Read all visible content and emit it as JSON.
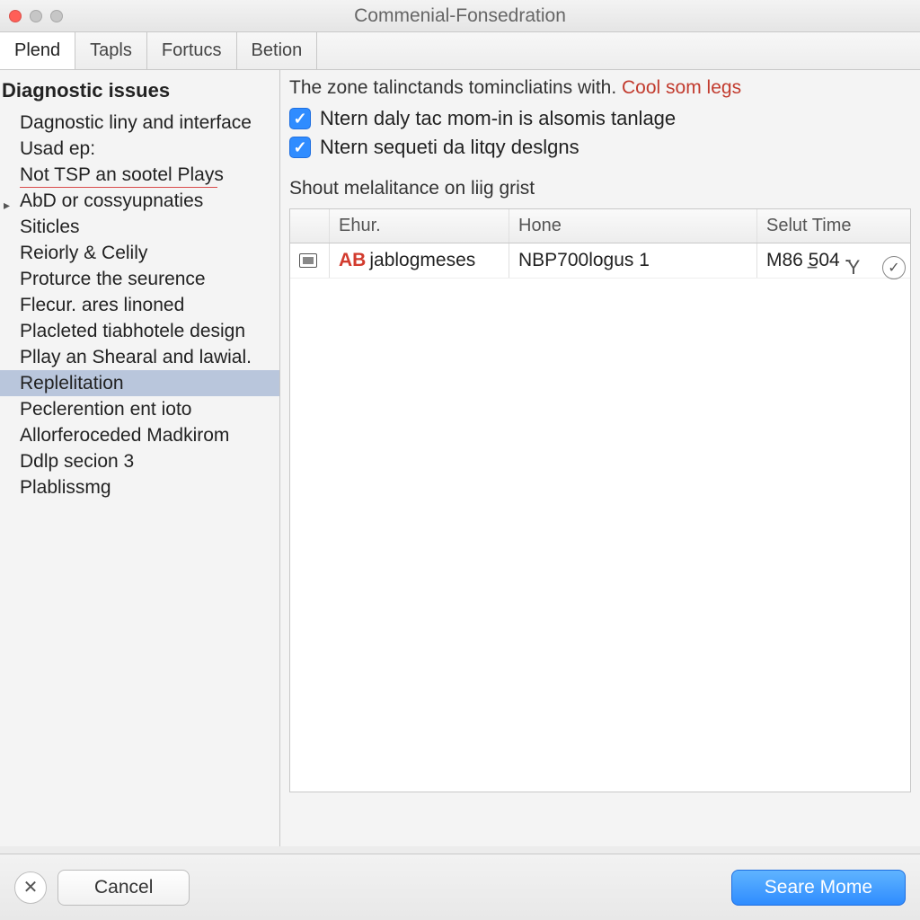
{
  "window": {
    "title": "Commenial-Fonsedration"
  },
  "tabs": [
    {
      "label": "Plend",
      "active": true
    },
    {
      "label": "Tapls",
      "active": false
    },
    {
      "label": "Fortucs",
      "active": false
    },
    {
      "label": "Betion",
      "active": false
    }
  ],
  "sidebar": {
    "header": "Diagnostic issues",
    "items": [
      {
        "label": "Dagnostic liny and interface",
        "selected": false,
        "hasDisclosure": false,
        "redline": false
      },
      {
        "label": "Usad ep:",
        "selected": false,
        "hasDisclosure": false,
        "redline": false
      },
      {
        "label": "Not TSP an sootel Plays",
        "selected": false,
        "hasDisclosure": false,
        "redline": true
      },
      {
        "label": "AbD or cossyupnaties",
        "selected": false,
        "hasDisclosure": true,
        "redline": false
      },
      {
        "label": "Siticles",
        "selected": false,
        "hasDisclosure": false,
        "redline": false
      },
      {
        "label": "Reiorly & Celily",
        "selected": false,
        "hasDisclosure": false,
        "redline": false
      },
      {
        "label": "Proturce the seurence",
        "selected": false,
        "hasDisclosure": false,
        "redline": false
      },
      {
        "label": "Flecur. ares linoned",
        "selected": false,
        "hasDisclosure": false,
        "redline": false
      },
      {
        "label": "Placleted tiabhotele design",
        "selected": false,
        "hasDisclosure": false,
        "redline": false
      },
      {
        "label": "Pllay an Shearal and lawial.",
        "selected": false,
        "hasDisclosure": false,
        "redline": false
      },
      {
        "label": "Replelitation",
        "selected": true,
        "hasDisclosure": false,
        "redline": false
      },
      {
        "label": "Peclerention ent ioto",
        "selected": false,
        "hasDisclosure": false,
        "redline": false
      },
      {
        "label": "Allorferoceded Madkirom",
        "selected": false,
        "hasDisclosure": false,
        "redline": false
      },
      {
        "label": "Ddlp secion 3",
        "selected": false,
        "hasDisclosure": false,
        "redline": false
      },
      {
        "label": "Plablissmg",
        "selected": false,
        "hasDisclosure": false,
        "redline": false
      }
    ]
  },
  "content": {
    "intro_prefix": "The zone talinctands tomincliatins with. ",
    "intro_link": "Cool som legs",
    "checks": [
      {
        "label": "Ntern daly tac mom-in is alsomis tanlage",
        "checked": true
      },
      {
        "label": "Ntern sequeti da litqy deslgns",
        "checked": true
      }
    ],
    "section_label": "Shout melalitance on liig grist",
    "toolbar": {
      "minus": "−",
      "y": "Y",
      "refresh": "✓"
    },
    "table": {
      "columns": [
        "Ehur.",
        "Hone",
        "Selut Time"
      ],
      "rows": [
        {
          "badge": "AB",
          "c1": "jablogmeses",
          "c2": "NBP700logus  1",
          "c3": "M86 504 -"
        }
      ]
    }
  },
  "footer": {
    "close_icon": "✕",
    "cancel": "Cancel",
    "primary": "Seare Mome"
  }
}
